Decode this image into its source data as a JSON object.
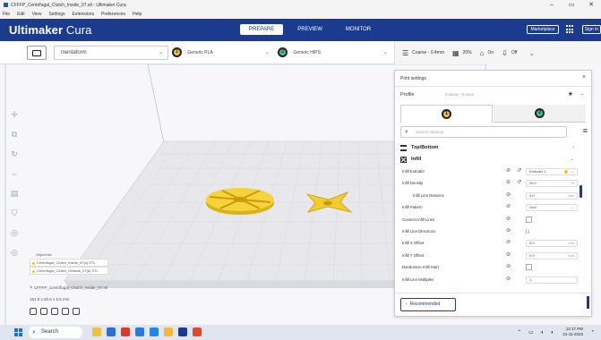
{
  "window": {
    "title": "CFFFP_Centrifugal_Clutch_Inside_07.stl - Ultimaker Cura",
    "controls": [
      "–",
      "▭",
      "✕"
    ]
  },
  "menu": [
    "File",
    "Edit",
    "View",
    "Settings",
    "Extensions",
    "Preferences",
    "Help"
  ],
  "header": {
    "brand_bold": "Ultimaker",
    "brand_light": "Cura",
    "stages": [
      "PREPARE",
      "PREVIEW",
      "MONITOR"
    ],
    "marketplace": "Marketplace",
    "signin": "Sign in",
    "accent": "#1b3b8e"
  },
  "toolbar": {
    "printer": "mentaform",
    "material1": {
      "num": "1",
      "name": "Generic PLA",
      "color": "#f2c230"
    },
    "material2": {
      "num": "2",
      "name": "Generic HIPS",
      "color": "#36c7a5"
    },
    "profile": "Coarse - 0.4mm",
    "infill": "20%",
    "support": "On",
    "adhesion": "Off"
  },
  "objects": {
    "header": "Object list",
    "items": [
      "Centrifugal_Clutch_Inside_07(s).STL",
      "Centrifugal_Clutch_Outside_07(s).STL"
    ],
    "selected_name": "CFFFP_Centrifugal_Clutch_Inside_07.stl",
    "dimensions": "154.9 x 60.6 x 6.5 mm"
  },
  "panel": {
    "title": "Print settings",
    "profile_label": "Profile",
    "profile_value": "Coarse - 0.4mm",
    "extruder_tabs": [
      "1",
      "2"
    ],
    "search_placeholder": "Search settings",
    "categories": [
      {
        "name": "Top/Bottom",
        "expanded": false
      },
      {
        "name": "Infill",
        "expanded": true
      }
    ],
    "rows": [
      {
        "label": "Infill Extruder",
        "link": true,
        "reset": true,
        "value": "Extruder 1",
        "kind": "dropdown-dot"
      },
      {
        "label": "Infill Density",
        "link": true,
        "reset": true,
        "value": "20.0",
        "unit": "%",
        "kind": "value"
      },
      {
        "label": "Infill Line Distance",
        "sub": true,
        "link": true,
        "value": "4.0",
        "unit": "mm",
        "kind": "value"
      },
      {
        "label": "Infill Pattern",
        "link": true,
        "value": "Grid",
        "kind": "dropdown"
      },
      {
        "label": "Connect Infill Lines",
        "link": true,
        "kind": "checkbox"
      },
      {
        "label": "Infill Line Directions",
        "link": true,
        "value": "[ ]",
        "kind": "plain"
      },
      {
        "label": "Infill X Offset",
        "link": true,
        "value": "0.0",
        "unit": "mm",
        "kind": "value"
      },
      {
        "label": "Infill Y Offset",
        "link": true,
        "value": "0.0",
        "unit": "mm",
        "kind": "value"
      },
      {
        "label": "Randomize Infill Start",
        "link": true,
        "kind": "checkbox"
      },
      {
        "label": "Infill Line Multiplier",
        "link": true,
        "value": "1",
        "kind": "value"
      }
    ],
    "recommended": "Recommended"
  },
  "taskbar": {
    "search": "Search",
    "time": "12:17 PM",
    "date": "21-11-2023"
  }
}
